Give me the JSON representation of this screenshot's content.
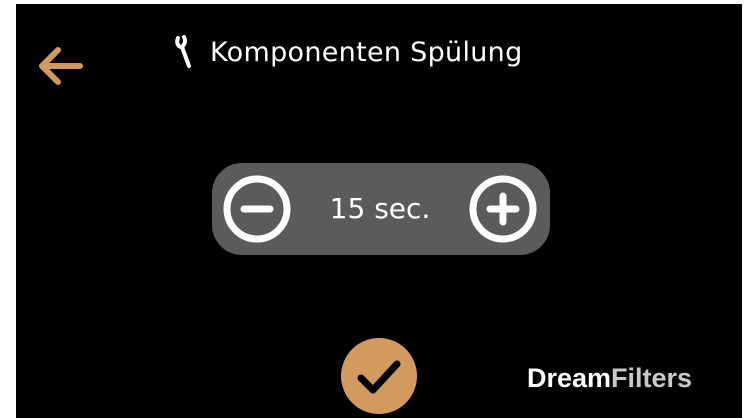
{
  "header": {
    "title": "Komponenten Spülung",
    "back_icon": "arrow-left-icon",
    "title_icon": "wrench-icon"
  },
  "stepper": {
    "value": "15 sec.",
    "minus_icon": "minus-circle-icon",
    "plus_icon": "plus-circle-icon"
  },
  "confirm": {
    "icon": "checkmark-icon"
  },
  "brand": {
    "part1": "Dream",
    "part2": "Filters"
  },
  "colors": {
    "accent": "#d29a5c",
    "background": "#000000",
    "stepper_bg": "#5b5b5b",
    "text": "#ffffff",
    "brand_part1": "#ffffff",
    "brand_part2": "#c9c9c9"
  }
}
